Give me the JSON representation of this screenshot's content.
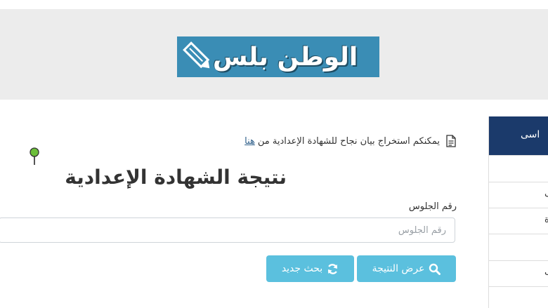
{
  "header": {
    "logo_text": "الوطن بلس"
  },
  "main": {
    "info_text": "يمكنكم استخراج بيان نجاح للشهادة الإعدادية من",
    "info_link": "هنا",
    "title": "نتيجة الشهادة الإعدادية",
    "seat_label": "رقم الجلوس",
    "seat_placeholder": "رقم الجلوس",
    "show_button": "عرض النتيجة",
    "new_search_button": "بحث جديد"
  },
  "sidebar": {
    "heading": "اسى",
    "rows": [
      "",
      "ف",
      "ة",
      "",
      "ب",
      ""
    ]
  },
  "colors": {
    "header_band": "#ececec",
    "logo_bg": "#3a8db5",
    "button": "#5bc0de",
    "sidebar_head": "#1b3a6b"
  }
}
